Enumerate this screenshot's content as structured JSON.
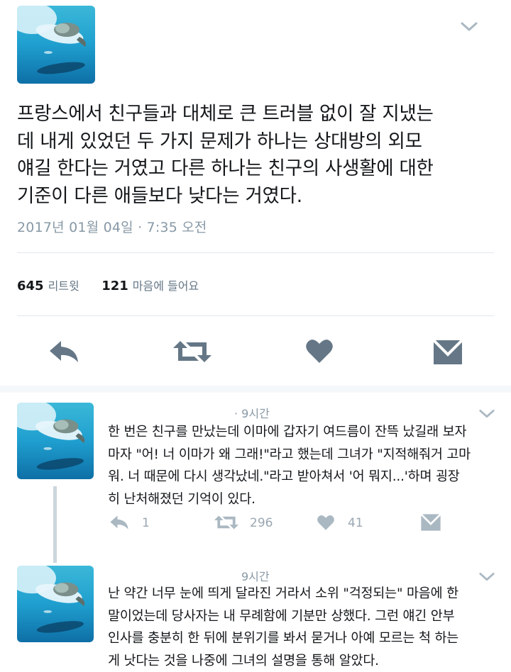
{
  "main_tweet": {
    "text": "프랑스에서 친구들과 대체로 큰 트러블 없이 잘 지냈는\n데 내게 있었던 두 가지 문제가 하나는 상대방의 외모\n얘길 한다는 거였고 다른 하나는 친구의 사생활에 대한\n기준이 다른 애들보다 낮다는 거였다.",
    "timestamp": "2017년 01월 04일 · 7:35 오전",
    "retweets_count": "645",
    "retweets_label": "리트윗",
    "likes_count": "121",
    "likes_label": "마음에 들어요"
  },
  "actions": {
    "reply_icon": "reply-icon",
    "retweet_icon": "retweet-icon",
    "like_icon": "heart-icon",
    "dm_icon": "envelope-icon"
  },
  "replies": [
    {
      "time": "· 9시간",
      "text": "한 번은 친구를 만났는데 이마에 갑자기 여드름이 잔뜩 났길래 보자\n마자 \"어! 너 이마가 왜 그래!\"라고 했는데 그녀가 \"지적해줘거 고마\n워. 너 때문에 다시 생각났네.\"라고 받아쳐서 '어 뭐지...'하며 굉장\n히 난처해졌던 기억이 있다.",
      "reply_count": "1",
      "retweet_count": "296",
      "like_count": "41"
    },
    {
      "time": "9시간",
      "text": "난 약간 너무 눈에 띄게 달라진 거라서 소위 \"걱정되는\" 마음에 한\n말이었는데 당사자는 내 무례함에 기분만 상했다. 그런 얘긴 안부\n인사를 충분히 한 뒤에 분위기를 봐서 묻거나 아예 모르는 척 하는\n게 낫다는 것을 나중에 그녀의 설명을 통해 알았다."
    }
  ],
  "colors": {
    "icon_dark": "#657786",
    "icon_light": "#aab8c2",
    "text_secondary": "#8899a6",
    "divider": "#e1e8ed",
    "thread_line": "#ccd6dd"
  }
}
